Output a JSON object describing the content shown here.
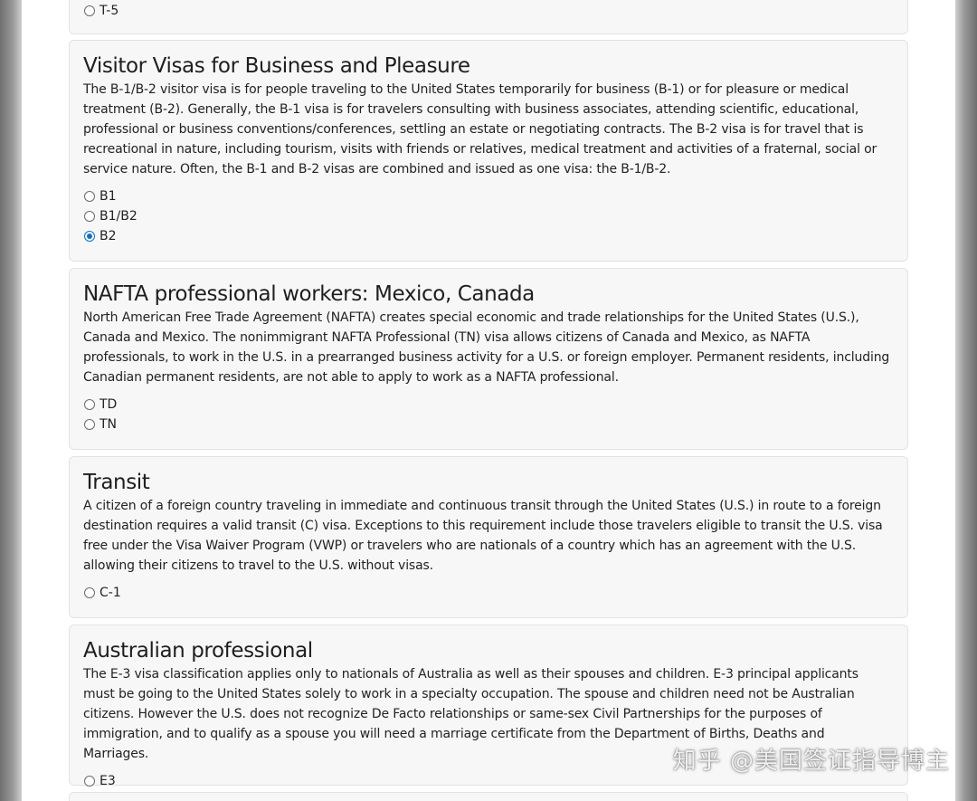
{
  "sections": [
    {
      "title": "",
      "description": "",
      "options": [
        {
          "label": "T-5",
          "checked": false
        }
      ]
    },
    {
      "title": "Visitor Visas for Business and Pleasure",
      "description": "The B-1/B-2 visitor visa is for people traveling to the United States temporarily for business (B-1) or for pleasure or medical treatment (B-2). Generally, the B-1 visa is for travelers consulting with business associates, attending scientific, educational, professional or business conventions/conferences, settling an estate or negotiating contracts. The B-2 visa is for travel that is recreational in nature, including tourism, visits with friends or relatives, medical treatment and activities of a fraternal, social or service nature. Often, the B-1 and B-2 visas are combined and issued as one visa: the B-1/B-2.",
      "options": [
        {
          "label": "B1",
          "checked": false
        },
        {
          "label": "B1/B2",
          "checked": false
        },
        {
          "label": "B2",
          "checked": true
        }
      ]
    },
    {
      "title": "NAFTA professional workers: Mexico, Canada",
      "description": "North American Free Trade Agreement (NAFTA) creates special economic and trade relationships for the United States (U.S.), Canada and Mexico. The nonimmigrant NAFTA Professional (TN) visa allows citizens of Canada and Mexico, as NAFTA professionals, to work in the U.S. in a prearranged business activity for a U.S. or foreign employer. Permanent residents, including Canadian permanent residents, are not able to apply to work as a NAFTA professional.",
      "options": [
        {
          "label": "TD",
          "checked": false
        },
        {
          "label": "TN",
          "checked": false
        }
      ]
    },
    {
      "title": "Transit",
      "description": "A citizen of a foreign country traveling in immediate and continuous transit through the United States (U.S.) in route to a foreign destination requires a valid transit (C) visa. Exceptions to this requirement include those travelers eligible to transit the U.S. visa free under the Visa Waiver Program (VWP) or travelers who are nationals of a country which has an agreement with the U.S. allowing their citizens to travel to the U.S. without visas.",
      "options": [
        {
          "label": "C-1",
          "checked": false
        }
      ]
    },
    {
      "title": "Australian professional",
      "description": "The E-3 visa classification applies only to nationals of Australia as well as their spouses and children. E-3 principal applicants must be going to the United States solely to work in a specialty occupation. The spouse and children need not be Australian citizens. However the U.S. does not recognize De Facto relationships or same-sex Civil Partnerships for the purposes of immigration, and to qualify as a spouse you will need a marriage certificate from the Department of Births, Deaths and Marriages.",
      "options": [
        {
          "label": "E3",
          "checked": false
        }
      ]
    }
  ],
  "watermark": "知乎 @美国签证指导博主"
}
